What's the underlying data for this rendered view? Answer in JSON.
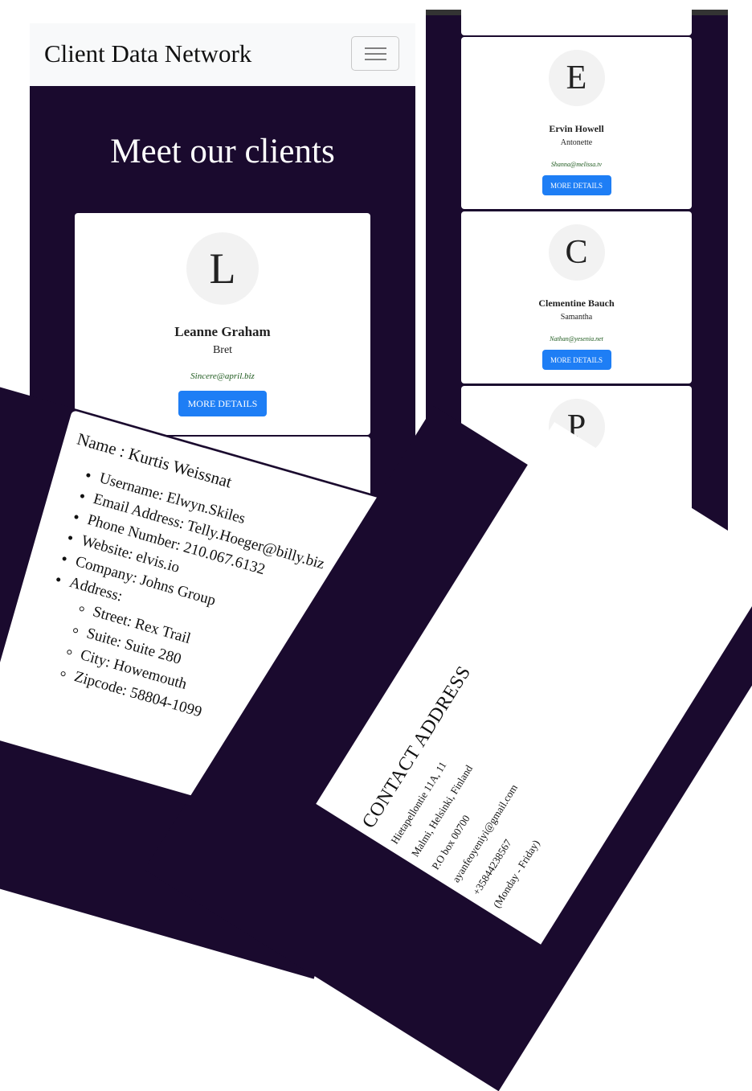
{
  "navbar": {
    "brand": "Client Data Network",
    "toggler_icon": "hamburger-icon"
  },
  "hero": {
    "title": "Meet our clients"
  },
  "clients": [
    {
      "initial": "L",
      "name": "Leanne Graham",
      "username": "Bret",
      "email": "Sincere@april.biz",
      "button": "MORE DETAILS"
    },
    {
      "initial": "E",
      "name": "Ervin Howell",
      "username": "Antonette",
      "email": "Shanna@melissa.tv",
      "button": "MORE DETAILS"
    },
    {
      "initial": "C",
      "name": "Clementine Bauch",
      "username": "Samantha",
      "email": "Nathan@yesenia.net",
      "button": "MORE DETAILS"
    },
    {
      "initial": "P"
    }
  ],
  "details": {
    "name_line": "Name : Kurtis Weissnat",
    "username": "Username: Elwyn.Skiles",
    "email": "Email Address: Telly.Hoeger@billy.biz",
    "phone": "Phone Number: 210.067.6132",
    "website": "Website: elvis.io",
    "company": "Company: Johns Group",
    "address_label": "Address:",
    "street": "Street: Rex Trail",
    "suite": "Suite: Suite 280",
    "city": "City: Howemouth",
    "zipcode": "Zipcode: 58804-1099"
  },
  "contact": {
    "heading": "CONTACT ADDRESS",
    "lines": [
      "Hietapellontie 11A, 11",
      "Malmi, Helsinki, Finland",
      "P.O box 00700",
      "ayanfeoyeniyi@gmail.com",
      "+35844238567",
      "(Monday - Friday)"
    ]
  },
  "colors": {
    "dark_bg": "#1a0a2e",
    "button_blue": "#1e7ef5",
    "navbar_bg": "#f8f9fa"
  }
}
